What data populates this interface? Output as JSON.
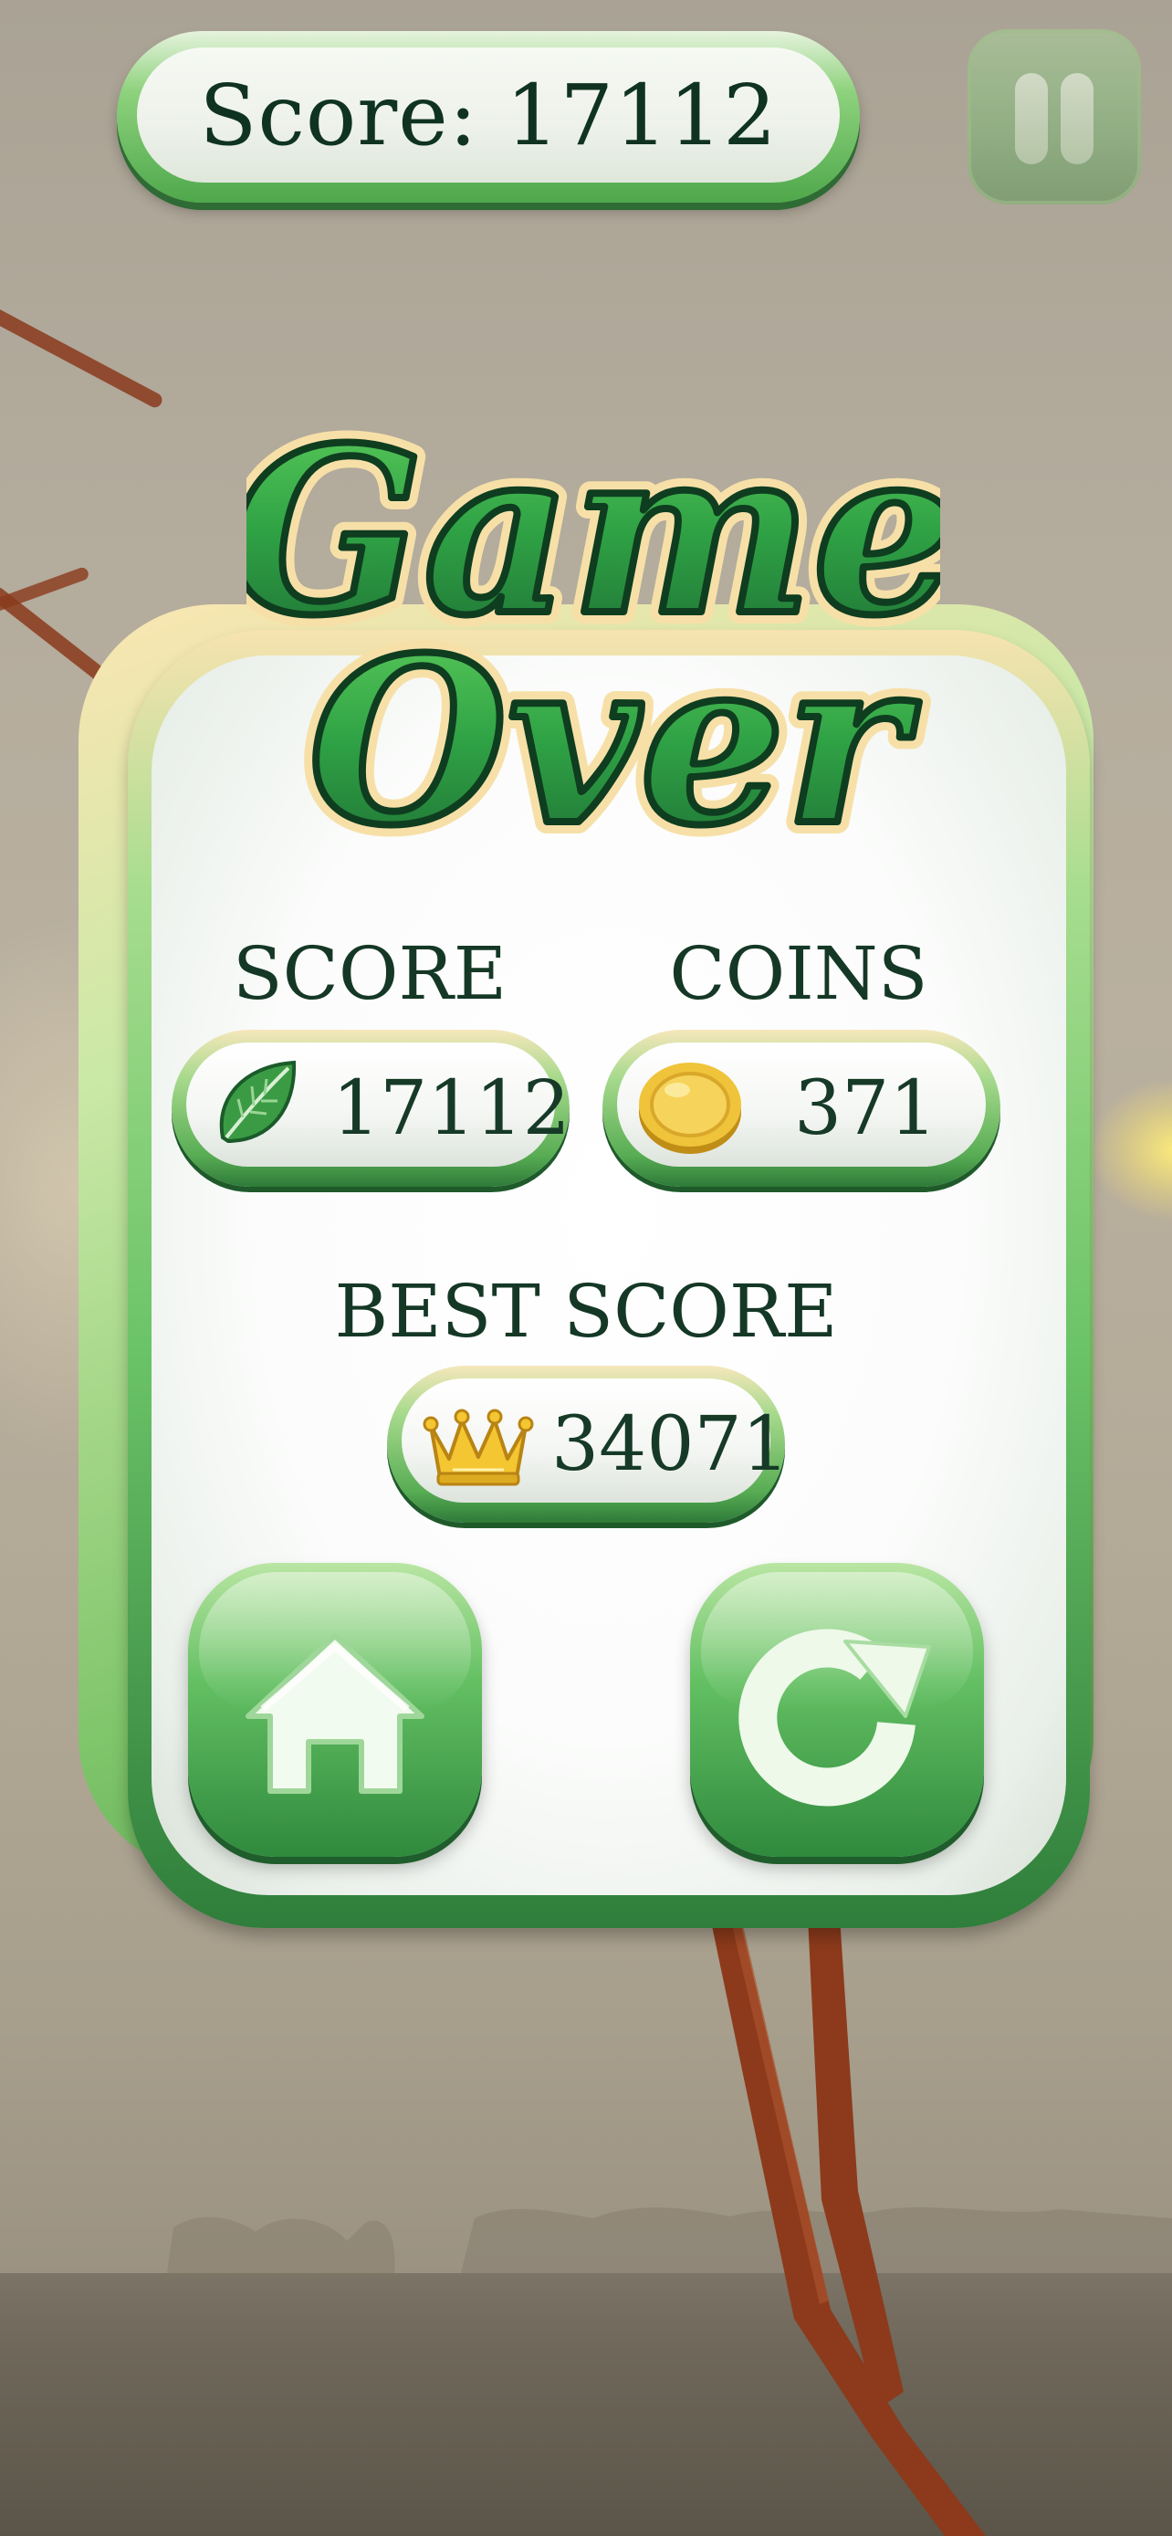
{
  "hud": {
    "score_text": "Score: 17112",
    "pause_icon": "pause-icon"
  },
  "title": {
    "line1": "Game",
    "line2": "Over"
  },
  "stats": {
    "score_label": "SCORE",
    "score_value": "17112",
    "score_icon": "leaf-icon",
    "coins_label": "COINS",
    "coins_value": "371",
    "coins_icon": "coin-icon",
    "best_label": "BEST SCORE",
    "best_value": "34071",
    "best_icon": "crown-icon"
  },
  "buttons": {
    "home_icon": "home-icon",
    "restart_icon": "restart-icon"
  },
  "colors": {
    "accent_green": "#4fa84b",
    "text_dark_green": "#153826",
    "background_haze": "#b4aa98"
  }
}
